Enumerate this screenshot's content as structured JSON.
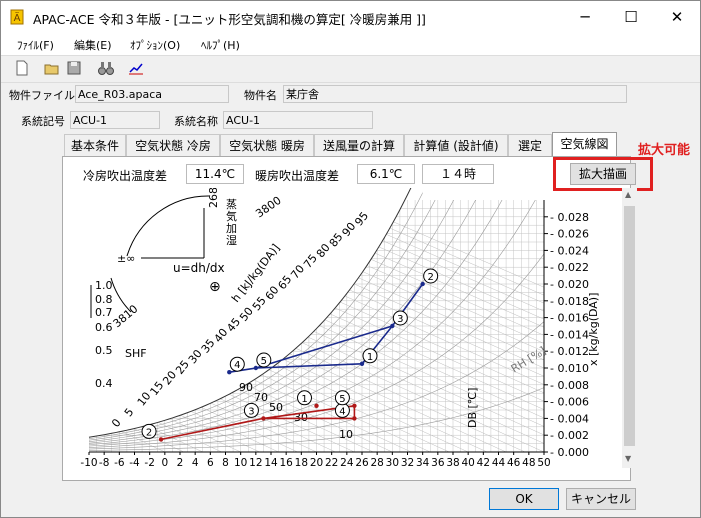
{
  "window": {
    "title": "APAC-ACE 令和３年版 - [ユニット形空気調和機の算定[ 冷暖房兼用 ]]",
    "minimize_icon": "minimize-icon",
    "maximize_icon": "maximize-icon",
    "close_icon": "close-icon"
  },
  "menu": [
    "ﾌｧｲﾙ(F)",
    "編集(E)",
    "ｵﾌﾟｼｮﾝ(O)",
    "ﾍﾙﾌﾟ(H)"
  ],
  "toolbar_icons": [
    "new-file-icon",
    "open-folder-icon",
    "save-icon",
    "binoculars-icon",
    "chart-icon"
  ],
  "info": {
    "file_label": "物件ファイル名",
    "file_value": "Ace_R03.apaca",
    "name_label": "物件名",
    "name_value": "某庁舎",
    "sys_code_label": "系統記号",
    "sys_code_value": "ACU-1",
    "sys_name_label": "系統名称",
    "sys_name_value": "ACU-1"
  },
  "tabs": [
    "基本条件",
    "空気状態 冷房",
    "空気状態 暖房",
    "送風量の計算",
    "計算値 (設計値)",
    "選定",
    "空気線図"
  ],
  "active_tab": 6,
  "panel": {
    "cool_label": "冷房吹出温度差",
    "cool_value": "11.4℃",
    "heat_label": "暖房吹出温度差",
    "heat_value": "6.1℃",
    "hour_value": "１４時",
    "enlarge_button": "拡大描画"
  },
  "annotation": "拡大可能",
  "buttons": {
    "ok": "OK",
    "cancel": "キャンセル"
  },
  "chart_data": {
    "type": "psychrometric",
    "x_axis": {
      "label": "DB [℃]",
      "min": -10,
      "max": 50,
      "ticks": [
        -10,
        -8,
        -6,
        -4,
        -2,
        0,
        2,
        4,
        6,
        8,
        10,
        12,
        14,
        16,
        18,
        20,
        22,
        24,
        26,
        28,
        30,
        32,
        34,
        36,
        38,
        40,
        42,
        44,
        46,
        48,
        50
      ]
    },
    "y_axis": {
      "label": "x [kg/kg(DA)]",
      "min": 0,
      "max": 0.03,
      "ticks": [
        "0.000",
        "0.002",
        "0.004",
        "0.006",
        "0.008",
        "0.010",
        "0.012",
        "0.014",
        "0.016",
        "0.018",
        "0.020",
        "0.022",
        "0.024",
        "0.026",
        "0.028"
      ]
    },
    "rh_labels": [
      "90",
      "70",
      "50",
      "30",
      "10"
    ],
    "rh_axis_label": "RH [%]",
    "enthalpy_label": "h [kJ/kg(DA)]",
    "enthalpy_ticks": [
      "0",
      "5",
      "10",
      "15",
      "20",
      "25",
      "30",
      "35",
      "40",
      "45",
      "50",
      "55",
      "60",
      "65",
      "70",
      "75",
      "80",
      "85",
      "90",
      "95"
    ],
    "shf_label": "SHF",
    "shf_ticks": [
      "1.0",
      "0.8",
      "0.7",
      "0.6",
      "0.5",
      "0.4"
    ],
    "protractor_labels": [
      "±∞",
      "3810",
      "2680",
      "3800",
      "蒸気加湿"
    ],
    "formula": "u=dh/dx",
    "cooling": {
      "color": "#1a2a8c",
      "points": [
        {
          "id": "1",
          "db": 26.0,
          "x": 0.0105
        },
        {
          "id": "2",
          "db": 34.0,
          "x": 0.02
        },
        {
          "id": "3",
          "db": 30.0,
          "x": 0.015
        },
        {
          "id": "4",
          "db": 8.5,
          "x": 0.0095
        },
        {
          "id": "5",
          "db": 12.0,
          "x": 0.01
        }
      ],
      "path": [
        "4",
        "5",
        "1",
        "3",
        "2",
        "3",
        "5"
      ]
    },
    "heating": {
      "color": "#b01818",
      "points": [
        {
          "id": "1",
          "db": 20.0,
          "x": 0.0055
        },
        {
          "id": "2",
          "db": -0.5,
          "x": 0.0015
        },
        {
          "id": "3",
          "db": 13.0,
          "x": 0.004
        },
        {
          "id": "4",
          "db": 25.0,
          "x": 0.004
        },
        {
          "id": "5",
          "db": 25.0,
          "x": 0.0055
        }
      ],
      "path": [
        "2",
        "3",
        "5",
        "4",
        "3"
      ]
    }
  }
}
